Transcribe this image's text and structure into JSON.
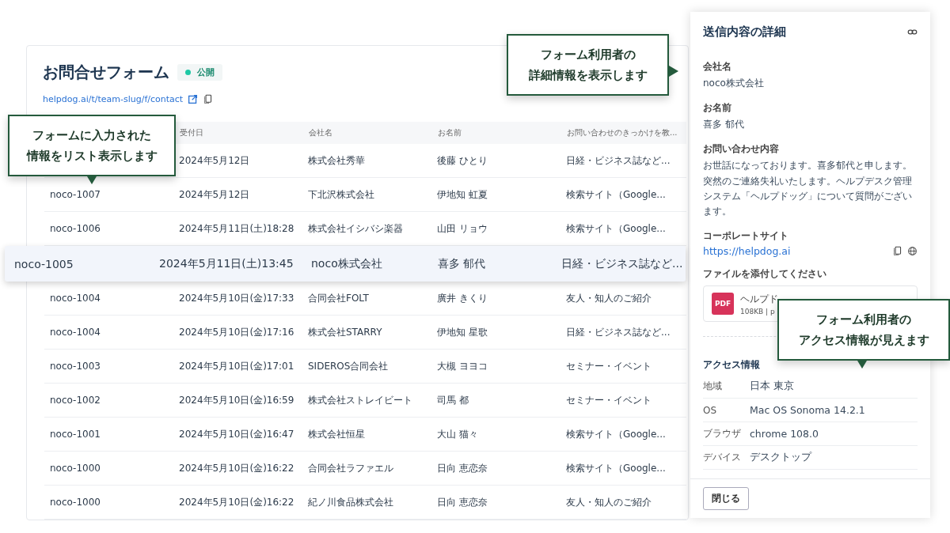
{
  "form": {
    "title": "お問合せフォーム",
    "status": {
      "label": "公開",
      "color": "#1ec8a5"
    },
    "url": "helpdog.ai/t/team-slug/f/contact"
  },
  "table": {
    "columns": [
      "受付日",
      "会社名",
      "お名前",
      "お問い合わせのきっかけを教..."
    ],
    "rows": [
      {
        "date": "2024年5月12日",
        "company": "株式会社秀華",
        "name": "後藤 ひとり",
        "source": "日経・ビジネス誌など...",
        "selected": false
      },
      {
        "id": "noco-1007",
        "date": "2024年5月12日",
        "company": "下北沢株式会社",
        "name": "伊地知 虹夏",
        "source": "検索サイト（Google...",
        "selected": false
      },
      {
        "id": "noco-1006",
        "date": "2024年5月11日(土)18:28",
        "company": "株式会社イシバシ楽器",
        "name": "山田 リョウ",
        "source": "検索サイト（Google...",
        "selected": false
      },
      {
        "id": "noco-1005",
        "date": "2024年5月11日(土)13:45",
        "company": "noco株式会社",
        "name": "喜多 郁代",
        "source": "日経・ビジネス誌など...",
        "selected": true
      },
      {
        "id": "noco-1004",
        "date": "2024年5月10日(金)17:33",
        "company": "合同会社FOLT",
        "name": "廣井 きくり",
        "source": "友人・知人のご紹介",
        "selected": false
      },
      {
        "id": "noco-1004",
        "date": "2024年5月10日(金)17:16",
        "company": "株式会社STARRY",
        "name": "伊地知 星歌",
        "source": "日経・ビジネス誌など...",
        "selected": false
      },
      {
        "id": "noco-1003",
        "date": "2024年5月10日(金)17:01",
        "company": "SIDEROS合同会社",
        "name": "大槻 ヨヨコ",
        "source": "セミナー・イベント",
        "selected": false
      },
      {
        "id": "noco-1002",
        "date": "2024年5月10日(金)16:59",
        "company": "株式会社ストレイビート",
        "name": "司馬 都",
        "source": "セミナー・イベント",
        "selected": false
      },
      {
        "id": "noco-1001",
        "date": "2024年5月10日(金)16:47",
        "company": "株式会社恒星",
        "name": "大山 猫々",
        "source": "検索サイト（Google...",
        "selected": false
      },
      {
        "id": "noco-1000",
        "date": "2024年5月10日(金)16:22",
        "company": "合同会社ラファエル",
        "name": "日向 恵恋奈",
        "source": "検索サイト（Google...",
        "selected": false
      },
      {
        "id": "noco-1000",
        "date": "2024年5月10日(金)16:22",
        "company": "紀ノ川食品株式会社",
        "name": "日向 恵恋奈",
        "source": "友人・知人のご紹介",
        "selected": false
      }
    ]
  },
  "panel": {
    "title": "送信内容の詳細",
    "fields": [
      {
        "kind": "text",
        "label": "会社名",
        "value": "noco株式会社"
      },
      {
        "kind": "text",
        "label": "お名前",
        "value": "喜多 郁代"
      },
      {
        "kind": "text",
        "label": "お問い合わせ内容",
        "value": "お世話になっております。喜多郁代と申します。突然のご連絡失礼いたします。ヘルプデスク管理システム「ヘルプドッグ」について質問がございます。"
      },
      {
        "kind": "link",
        "label": "コーポレートサイト",
        "value": "https://helpdog.ai"
      },
      {
        "kind": "file",
        "label": "ファイルを添付してください",
        "file": {
          "type": "PDF",
          "name": "ヘルプド",
          "meta": "108KB | p"
        }
      }
    ],
    "access": {
      "title": "アクセス情報",
      "rows": [
        {
          "label": "地域",
          "value": "日本 東京"
        },
        {
          "label": "OS",
          "value": "Mac OS Sonoma 14.2.1"
        },
        {
          "label": "ブラウザ",
          "value": "chrome 108.0"
        },
        {
          "label": "デバイス",
          "value": "デスクトップ"
        }
      ]
    },
    "close_button": "閉じる"
  },
  "callouts": [
    {
      "lines": [
        "フォームに入力された",
        "情報をリスト表示します"
      ]
    },
    {
      "lines": [
        "フォーム利用者の",
        "詳細情報を表示します"
      ]
    },
    {
      "lines": [
        "フォーム利用者の",
        "アクセス情報が見えます"
      ]
    }
  ]
}
